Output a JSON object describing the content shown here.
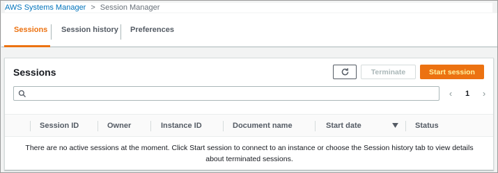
{
  "breadcrumb": {
    "root": "AWS Systems Manager",
    "separator": ">",
    "current": "Session Manager"
  },
  "tabs": [
    {
      "label": "Sessions",
      "active": true
    },
    {
      "label": "Session history",
      "active": false
    },
    {
      "label": "Preferences",
      "active": false
    }
  ],
  "panel": {
    "title": "Sessions",
    "refresh_icon": "refresh-icon",
    "terminate_label": "Terminate",
    "start_label": "Start session"
  },
  "search": {
    "icon": "search-icon",
    "placeholder": "",
    "value": ""
  },
  "pagination": {
    "prev": "‹",
    "page": "1",
    "next": "›"
  },
  "table": {
    "columns": [
      "Session ID",
      "Owner",
      "Instance ID",
      "Document name",
      "Start date",
      "Status"
    ],
    "sorted_column": "Start date",
    "empty_message": "There are no active sessions at the moment. Click Start session to connect to an instance or choose the Session history tab to view details about terminated sessions."
  },
  "colors": {
    "accent": "#ec7211",
    "link": "#0073bb",
    "start_text": "#fff3a0"
  }
}
